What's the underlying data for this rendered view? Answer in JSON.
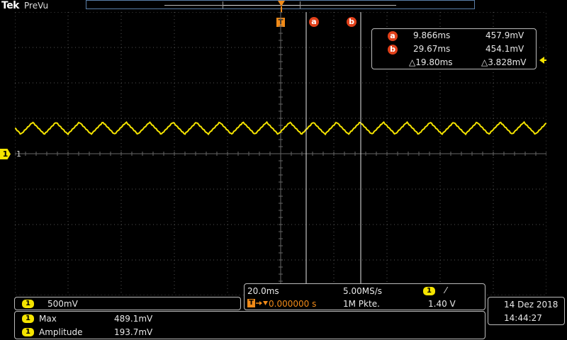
{
  "topbar": {
    "brand": "Tek",
    "mode": "PreVu"
  },
  "trigger_marker": {
    "letter": "T"
  },
  "cursors": [
    {
      "label": "a",
      "time": "9.866ms",
      "value": "457.9mV"
    },
    {
      "label": "b",
      "time": "29.67ms",
      "value": "454.1mV"
    }
  ],
  "cursor_delta": {
    "time": "△19.80ms",
    "value": "△3.828mV"
  },
  "channel": {
    "number": "1",
    "grid_label": "1",
    "scale": "500mV",
    "color": "#f5e400"
  },
  "measurements": [
    {
      "channel": "1",
      "name": "Max",
      "value": "489.1mV"
    },
    {
      "channel": "1",
      "name": "Amplitude",
      "value": "193.7mV"
    }
  ],
  "timebase": {
    "scale": "20.0ms",
    "sample_rate": "5.00MS/s",
    "position": "0.000000 s",
    "record_length": "1M Pkte.",
    "trigger_channel": "1",
    "trigger_slope": "⁄",
    "trigger_level": "1.40 V"
  },
  "datetime": {
    "date": "14 Dez  2018",
    "time": "14:44:27"
  },
  "colors": {
    "trace": "#f5e400",
    "cursor_badge": "#e0401a",
    "trigger": "#f08a18",
    "grid": "#5a5a5a"
  }
}
